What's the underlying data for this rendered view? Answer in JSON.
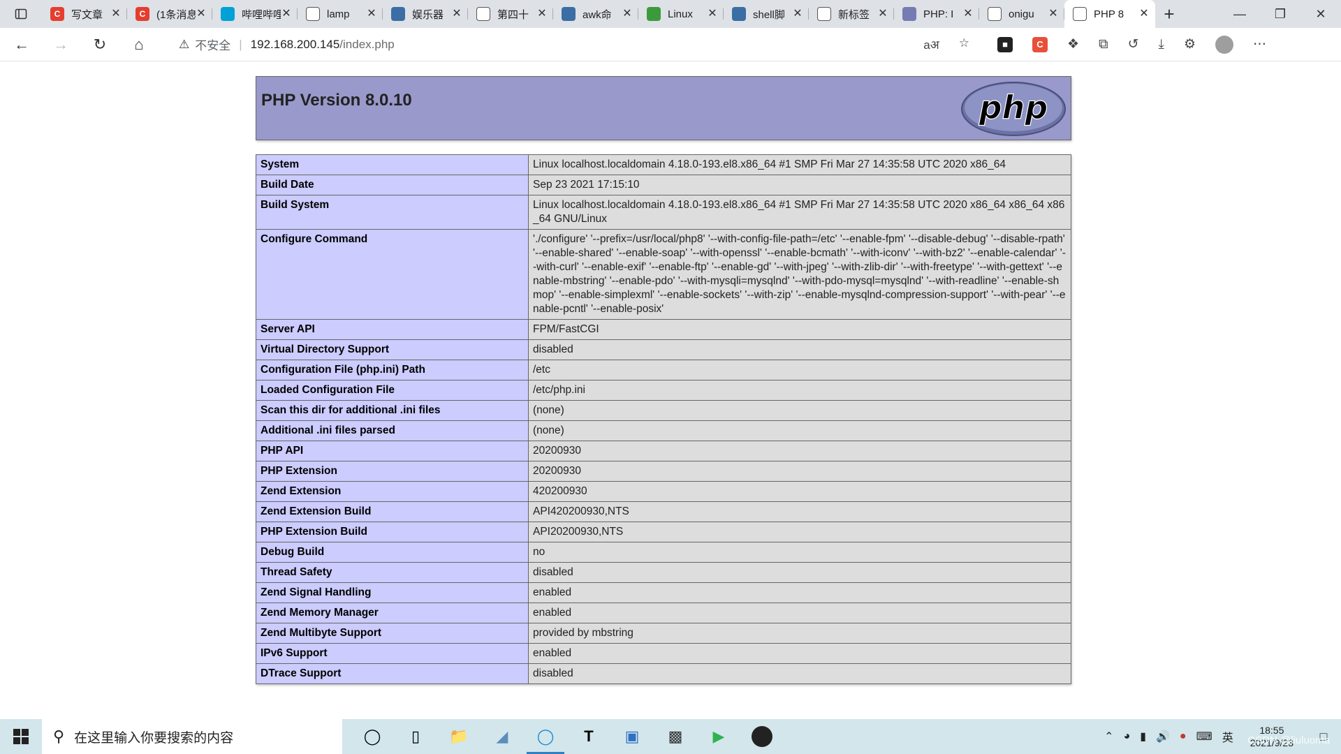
{
  "browser": {
    "tabs": [
      {
        "title": "写文章",
        "icon_color": "#e53e2e",
        "icon_letter": "C"
      },
      {
        "title": "(1条消息",
        "icon_color": "#e53e2e",
        "icon_letter": "C"
      },
      {
        "title": "哔哩哔哩",
        "icon_color": "#00a1d6",
        "icon_letter": ""
      },
      {
        "title": "lamp",
        "icon_color": "#ffffff",
        "icon_letter": ""
      },
      {
        "title": "娱乐器",
        "icon_color": "#3a6ea5",
        "icon_letter": ""
      },
      {
        "title": "第四十",
        "icon_color": "#ffffff",
        "icon_letter": ""
      },
      {
        "title": "awk命",
        "icon_color": "#3a6ea5",
        "icon_letter": ""
      },
      {
        "title": "Linux",
        "icon_color": "#3c9a3c",
        "icon_letter": ""
      },
      {
        "title": "shell脚",
        "icon_color": "#3a6ea5",
        "icon_letter": ""
      },
      {
        "title": "新标签",
        "icon_color": "#ffffff",
        "icon_letter": ""
      },
      {
        "title": "PHP: I",
        "icon_color": "#777bb3",
        "icon_letter": ""
      },
      {
        "title": "onigu",
        "icon_color": "#ffffff",
        "icon_letter": ""
      },
      {
        "title": "PHP 8",
        "icon_color": "#ffffff",
        "icon_letter": "",
        "active": true
      }
    ],
    "insecure_label": "不安全",
    "url_host": "192.168.200.145",
    "url_path": "/index.php"
  },
  "phpinfo": {
    "title": "PHP Version 8.0.10",
    "logo_text": "php",
    "rows": [
      {
        "key": "System",
        "value": "Linux localhost.localdomain 4.18.0-193.el8.x86_64 #1 SMP Fri Mar 27 14:35:58 UTC 2020 x86_64"
      },
      {
        "key": "Build Date",
        "value": "Sep 23 2021 17:15:10"
      },
      {
        "key": "Build System",
        "value": "Linux localhost.localdomain 4.18.0-193.el8.x86_64 #1 SMP Fri Mar 27 14:35:58 UTC 2020 x86_64 x86_64 x86_64 GNU/Linux"
      },
      {
        "key": "Configure Command",
        "value": "'./configure' '--prefix=/usr/local/php8' '--with-config-file-path=/etc' '--enable-fpm' '--disable-debug' '--disable-rpath' '--enable-shared' '--enable-soap' '--with-openssl' '--enable-bcmath' '--with-iconv' '--with-bz2' '--enable-calendar' '--with-curl' '--enable-exif' '--enable-ftp' '--enable-gd' '--with-jpeg' '--with-zlib-dir' '--with-freetype' '--with-gettext' '--enable-mbstring' '--enable-pdo' '--with-mysqli=mysqlnd' '--with-pdo-mysql=mysqlnd' '--with-readline' '--enable-shmop' '--enable-simplexml' '--enable-sockets' '--with-zip' '--enable-mysqlnd-compression-support' '--with-pear' '--enable-pcntl' '--enable-posix'"
      },
      {
        "key": "Server API",
        "value": "FPM/FastCGI"
      },
      {
        "key": "Virtual Directory Support",
        "value": "disabled"
      },
      {
        "key": "Configuration File (php.ini) Path",
        "value": "/etc"
      },
      {
        "key": "Loaded Configuration File",
        "value": "/etc/php.ini"
      },
      {
        "key": "Scan this dir for additional .ini files",
        "value": "(none)"
      },
      {
        "key": "Additional .ini files parsed",
        "value": "(none)"
      },
      {
        "key": "PHP API",
        "value": "20200930"
      },
      {
        "key": "PHP Extension",
        "value": "20200930"
      },
      {
        "key": "Zend Extension",
        "value": "420200930"
      },
      {
        "key": "Zend Extension Build",
        "value": "API420200930,NTS"
      },
      {
        "key": "PHP Extension Build",
        "value": "API20200930,NTS"
      },
      {
        "key": "Debug Build",
        "value": "no"
      },
      {
        "key": "Thread Safety",
        "value": "disabled"
      },
      {
        "key": "Zend Signal Handling",
        "value": "enabled"
      },
      {
        "key": "Zend Memory Manager",
        "value": "enabled"
      },
      {
        "key": "Zend Multibyte Support",
        "value": "provided by mbstring"
      },
      {
        "key": "IPv6 Support",
        "value": "enabled"
      },
      {
        "key": "DTrace Support",
        "value": "disabled"
      }
    ]
  },
  "taskbar": {
    "search_placeholder": "在这里输入你要搜索的内容",
    "ime_label": "英",
    "time": "18:55",
    "date": "2021/9/23",
    "watermark": "CSDN @liuluoma"
  }
}
